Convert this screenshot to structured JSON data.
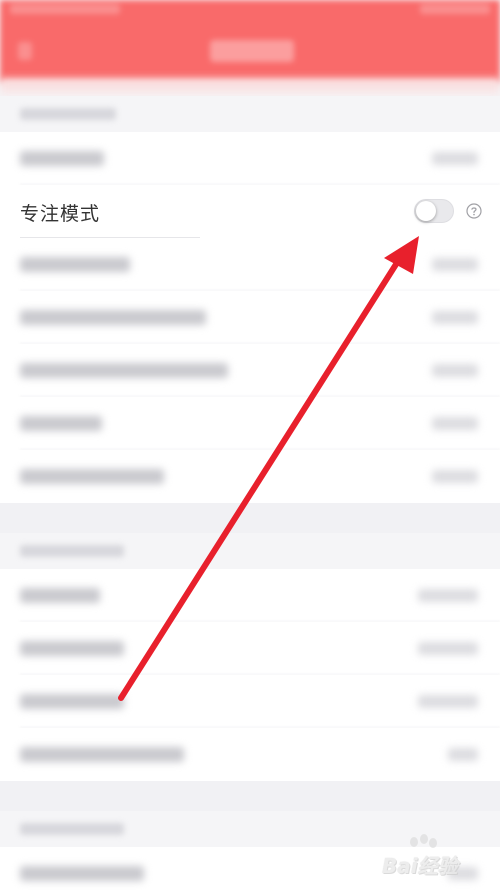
{
  "settings": {
    "focus_mode": {
      "label": "专注模式",
      "enabled": false
    }
  },
  "icons": {
    "help": "question-circle-icon"
  },
  "colors": {
    "header": "#f96a6a",
    "arrow": "#e8202c",
    "toggle_off": "#e9e9ec",
    "text": "#333333"
  },
  "watermark": {
    "text": "Bai经验"
  }
}
